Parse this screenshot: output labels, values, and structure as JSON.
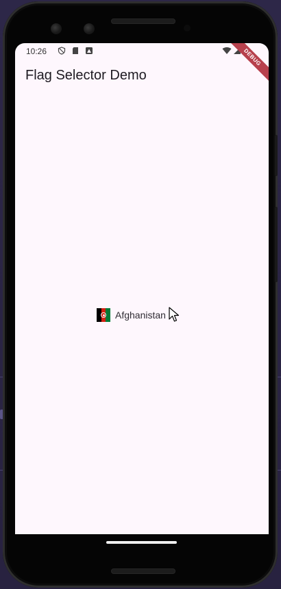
{
  "status_bar": {
    "time": "10:26",
    "icons": [
      "shield-icon",
      "sd-card-icon",
      "image-badge-icon",
      "wifi-icon",
      "signal-icon",
      "battery-icon"
    ]
  },
  "debug_banner": {
    "label": "DEBUG",
    "color": "#b7414d"
  },
  "app_bar": {
    "title": "Flag Selector Demo"
  },
  "country_selector": {
    "selected_country": "Afghanistan",
    "flag_icon": "afghanistan-flag-icon",
    "flag_colors": [
      "#000000",
      "#d32011",
      "#007a36"
    ],
    "expand_icon": "dropdown-arrow-icon"
  },
  "colors": {
    "screen_background": "#fef7fd",
    "title_text": "#1e1b22",
    "device_frame": "#050505"
  }
}
